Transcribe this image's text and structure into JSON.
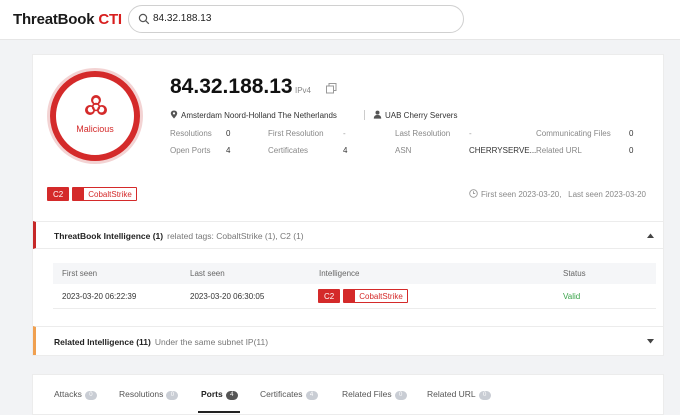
{
  "header": {
    "brand_main": "ThreatBook",
    "brand_accent": "CTI",
    "search_value": "84.32.188.13"
  },
  "summary": {
    "verdict": "Malicious",
    "ip": "84.32.188.13",
    "ip_version": "IPv4",
    "location": "Amsterdam Noord-Holland The Netherlands",
    "org": "UAB Cherry Servers",
    "stats": {
      "resolutions_label": "Resolutions",
      "resolutions": "0",
      "first_resolution_label": "First Resolution",
      "first_resolution": "-",
      "last_resolution_label": "Last Resolution",
      "last_resolution": "-",
      "communicating_files_label": "Communicating Files",
      "communicating_files": "0",
      "open_ports_label": "Open Ports",
      "open_ports": "4",
      "certificates_label": "Certificates",
      "certificates": "4",
      "asn_label": "ASN",
      "asn": "CHERRYSERVE...",
      "related_url_label": "Related URL",
      "related_url": "0"
    },
    "tags": [
      "C2",
      "CobaltStrike"
    ],
    "first_seen": "First seen 2023-03-20,",
    "last_seen": "Last seen 2023-03-20"
  },
  "intelligence": {
    "title": "ThreatBook Intelligence (1)",
    "subtitle": "related tags: CobaltStrike (1), C2 (1)",
    "columns": [
      "First seen",
      "Last seen",
      "Intelligence",
      "Status"
    ],
    "rows": [
      {
        "first_seen": "2023-03-20 06:22:39",
        "last_seen": "2023-03-20 06:30:05",
        "tags": [
          "C2",
          "CobaltStrike"
        ],
        "status": "Valid"
      }
    ]
  },
  "related": {
    "title": "Related Intelligence (11)",
    "subtitle": "Under the same subnet IP(11)"
  },
  "tabs": [
    {
      "label": "Attacks",
      "count": "0"
    },
    {
      "label": "Resolutions",
      "count": "0"
    },
    {
      "label": "Ports",
      "count": "4"
    },
    {
      "label": "Certificates",
      "count": "4"
    },
    {
      "label": "Related Files",
      "count": "0"
    },
    {
      "label": "Related URL",
      "count": "0"
    }
  ],
  "colors": {
    "accent": "#d42a2a",
    "valid": "#3aa34a",
    "related_accent": "#f0a050"
  }
}
